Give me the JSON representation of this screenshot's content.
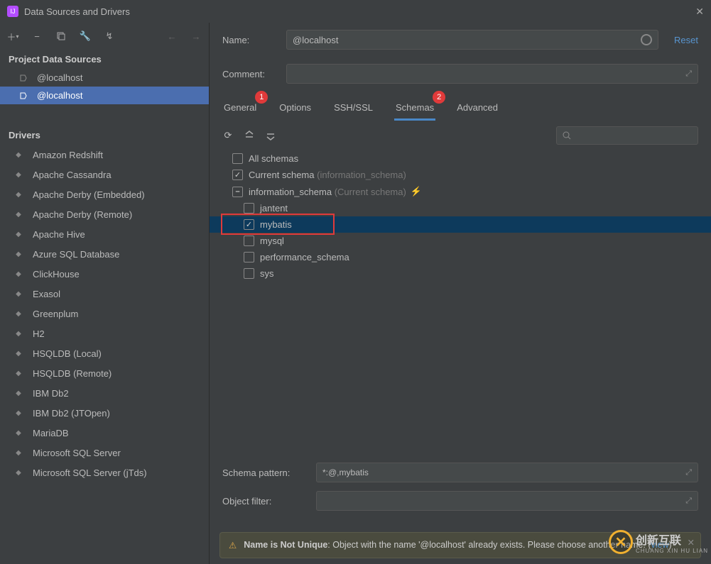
{
  "title": "Data Sources and Drivers",
  "left": {
    "section_ds": "Project Data Sources",
    "datasources": [
      {
        "label": "@localhost",
        "selected": false
      },
      {
        "label": "@localhost",
        "selected": true
      }
    ],
    "section_drivers": "Drivers",
    "drivers": [
      "Amazon Redshift",
      "Apache Cassandra",
      "Apache Derby (Embedded)",
      "Apache Derby (Remote)",
      "Apache Hive",
      "Azure SQL Database",
      "ClickHouse",
      "Exasol",
      "Greenplum",
      "H2",
      "HSQLDB (Local)",
      "HSQLDB (Remote)",
      "IBM Db2",
      "IBM Db2 (JTOpen)",
      "MariaDB",
      "Microsoft SQL Server",
      "Microsoft SQL Server (jTds)"
    ]
  },
  "form": {
    "name_label": "Name:",
    "name_value": "@localhost",
    "reset": "Reset",
    "comment_label": "Comment:"
  },
  "tabs": [
    {
      "label": "General",
      "badge": "1"
    },
    {
      "label": "Options"
    },
    {
      "label": "SSH/SSL"
    },
    {
      "label": "Schemas",
      "badge": "2",
      "active": true
    },
    {
      "label": "Advanced"
    }
  ],
  "schemas": {
    "all": "All schemas",
    "current": "Current schema",
    "current_hint": "(information_schema)",
    "info": "information_schema",
    "info_hint": "(Current schema)",
    "children": [
      {
        "label": "jantent",
        "checked": false
      },
      {
        "label": "mybatis",
        "checked": true,
        "highlight": true
      },
      {
        "label": "mysql",
        "checked": false
      },
      {
        "label": "performance_schema",
        "checked": false
      },
      {
        "label": "sys",
        "checked": false
      }
    ]
  },
  "bottom": {
    "pattern_label": "Schema pattern:",
    "pattern_value": "*:@,mybatis",
    "filter_label": "Object filter:"
  },
  "warning": {
    "title": "Name is Not Unique",
    "msg_a": ": Object with the name '@localhost' already exists. Please choose another name. (",
    "link": "view",
    "msg_b": ")"
  },
  "brand": {
    "text": "创新互联",
    "sub": "CHUANG XIN HU LIAN"
  }
}
